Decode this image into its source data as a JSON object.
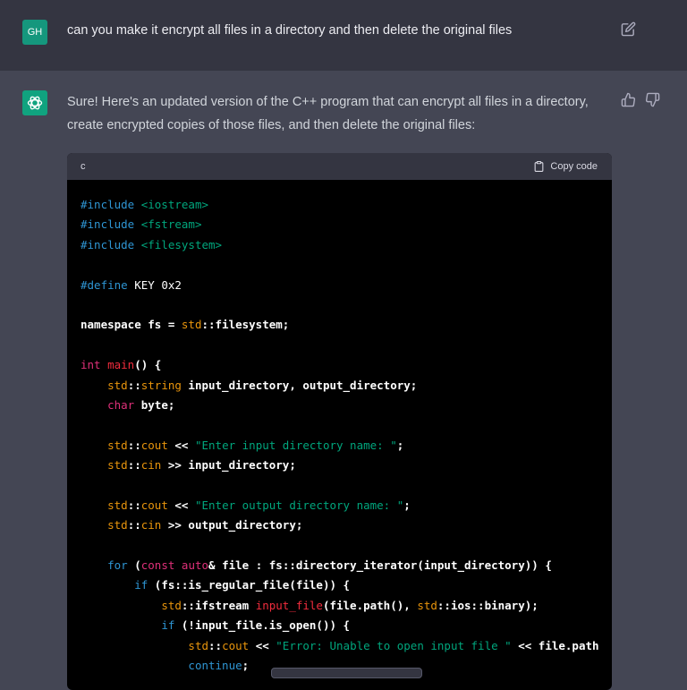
{
  "user_message": {
    "avatar_text": "GH",
    "text": "can you make it encrypt all files in a directory and then delete the original files"
  },
  "assistant_message": {
    "text": "Sure! Here's an updated version of the C++ program that can encrypt all files in a directory, create encrypted copies of those files, and then delete the original files:"
  },
  "code_block": {
    "language": "c",
    "copy_label": "Copy code",
    "lines": [
      [
        [
          "kw",
          "#include "
        ],
        [
          "str",
          "<iostream>"
        ]
      ],
      [
        [
          "kw",
          "#include "
        ],
        [
          "str",
          "<fstream>"
        ]
      ],
      [
        [
          "kw",
          "#include "
        ],
        [
          "str",
          "<filesystem>"
        ]
      ],
      [],
      [
        [
          "kw",
          "#define"
        ],
        [
          "plain",
          " KEY 0x2"
        ]
      ],
      [],
      [
        [
          "txt",
          "namespace fs = "
        ],
        [
          "ns",
          "std"
        ],
        [
          "txt",
          "::filesystem;"
        ]
      ],
      [],
      [
        [
          "type",
          "int"
        ],
        [
          "txt",
          " "
        ],
        [
          "fn",
          "main"
        ],
        [
          "txt",
          "() {"
        ]
      ],
      [
        [
          "txt",
          "    "
        ],
        [
          "ns",
          "std"
        ],
        [
          "txt",
          "::"
        ],
        [
          "ns",
          "string"
        ],
        [
          "txt",
          " input_directory, output_directory;"
        ]
      ],
      [
        [
          "txt",
          "    "
        ],
        [
          "type",
          "char"
        ],
        [
          "txt",
          " byte;"
        ]
      ],
      [],
      [
        [
          "txt",
          "    "
        ],
        [
          "ns",
          "std"
        ],
        [
          "txt",
          "::"
        ],
        [
          "ns",
          "cout"
        ],
        [
          "txt",
          " << "
        ],
        [
          "str",
          "\"Enter input directory name: \""
        ],
        [
          "txt",
          ";"
        ]
      ],
      [
        [
          "txt",
          "    "
        ],
        [
          "ns",
          "std"
        ],
        [
          "txt",
          "::"
        ],
        [
          "ns",
          "cin"
        ],
        [
          "txt",
          " >> input_directory;"
        ]
      ],
      [],
      [
        [
          "txt",
          "    "
        ],
        [
          "ns",
          "std"
        ],
        [
          "txt",
          "::"
        ],
        [
          "ns",
          "cout"
        ],
        [
          "txt",
          " << "
        ],
        [
          "str",
          "\"Enter output directory name: \""
        ],
        [
          "txt",
          ";"
        ]
      ],
      [
        [
          "txt",
          "    "
        ],
        [
          "ns",
          "std"
        ],
        [
          "txt",
          "::"
        ],
        [
          "ns",
          "cin"
        ],
        [
          "txt",
          " >> output_directory;"
        ]
      ],
      [],
      [
        [
          "txt",
          "    "
        ],
        [
          "kw",
          "for"
        ],
        [
          "txt",
          " ("
        ],
        [
          "type",
          "const"
        ],
        [
          "txt",
          " "
        ],
        [
          "type",
          "auto"
        ],
        [
          "txt",
          "& file : fs::directory_iterator(input_directory)) {"
        ]
      ],
      [
        [
          "txt",
          "        "
        ],
        [
          "kw",
          "if"
        ],
        [
          "txt",
          " (fs::is_regular_file(file)) {"
        ]
      ],
      [
        [
          "txt",
          "            "
        ],
        [
          "ns",
          "std"
        ],
        [
          "txt",
          "::ifstream "
        ],
        [
          "fn",
          "input_file"
        ],
        [
          "txt",
          "(file.path(), "
        ],
        [
          "ns",
          "std"
        ],
        [
          "txt",
          "::ios::binary);"
        ]
      ],
      [
        [
          "txt",
          "            "
        ],
        [
          "kw",
          "if"
        ],
        [
          "txt",
          " (!input_file.is_open()) {"
        ]
      ],
      [
        [
          "txt",
          "                "
        ],
        [
          "ns",
          "std"
        ],
        [
          "txt",
          "::"
        ],
        [
          "ns",
          "cout"
        ],
        [
          "txt",
          " << "
        ],
        [
          "str",
          "\"Error: Unable to open input file \""
        ],
        [
          "txt",
          " << file.path"
        ]
      ],
      [
        [
          "txt",
          "                "
        ],
        [
          "kw",
          "continue"
        ],
        [
          "txt",
          ";"
        ]
      ]
    ]
  },
  "icons": {
    "user_edit": "edit-icon",
    "assistant_avatar": "openai-logo-icon",
    "like": "thumbs-up-icon",
    "dislike": "thumbs-down-icon",
    "copy": "clipboard-icon"
  },
  "colors": {
    "user_bg": "#343541",
    "assistant_bg": "#444654",
    "user_avatar": "#15977d",
    "assistant_avatar": "#10a37f",
    "code_bg": "#000000",
    "code_header_bg": "#343541"
  }
}
